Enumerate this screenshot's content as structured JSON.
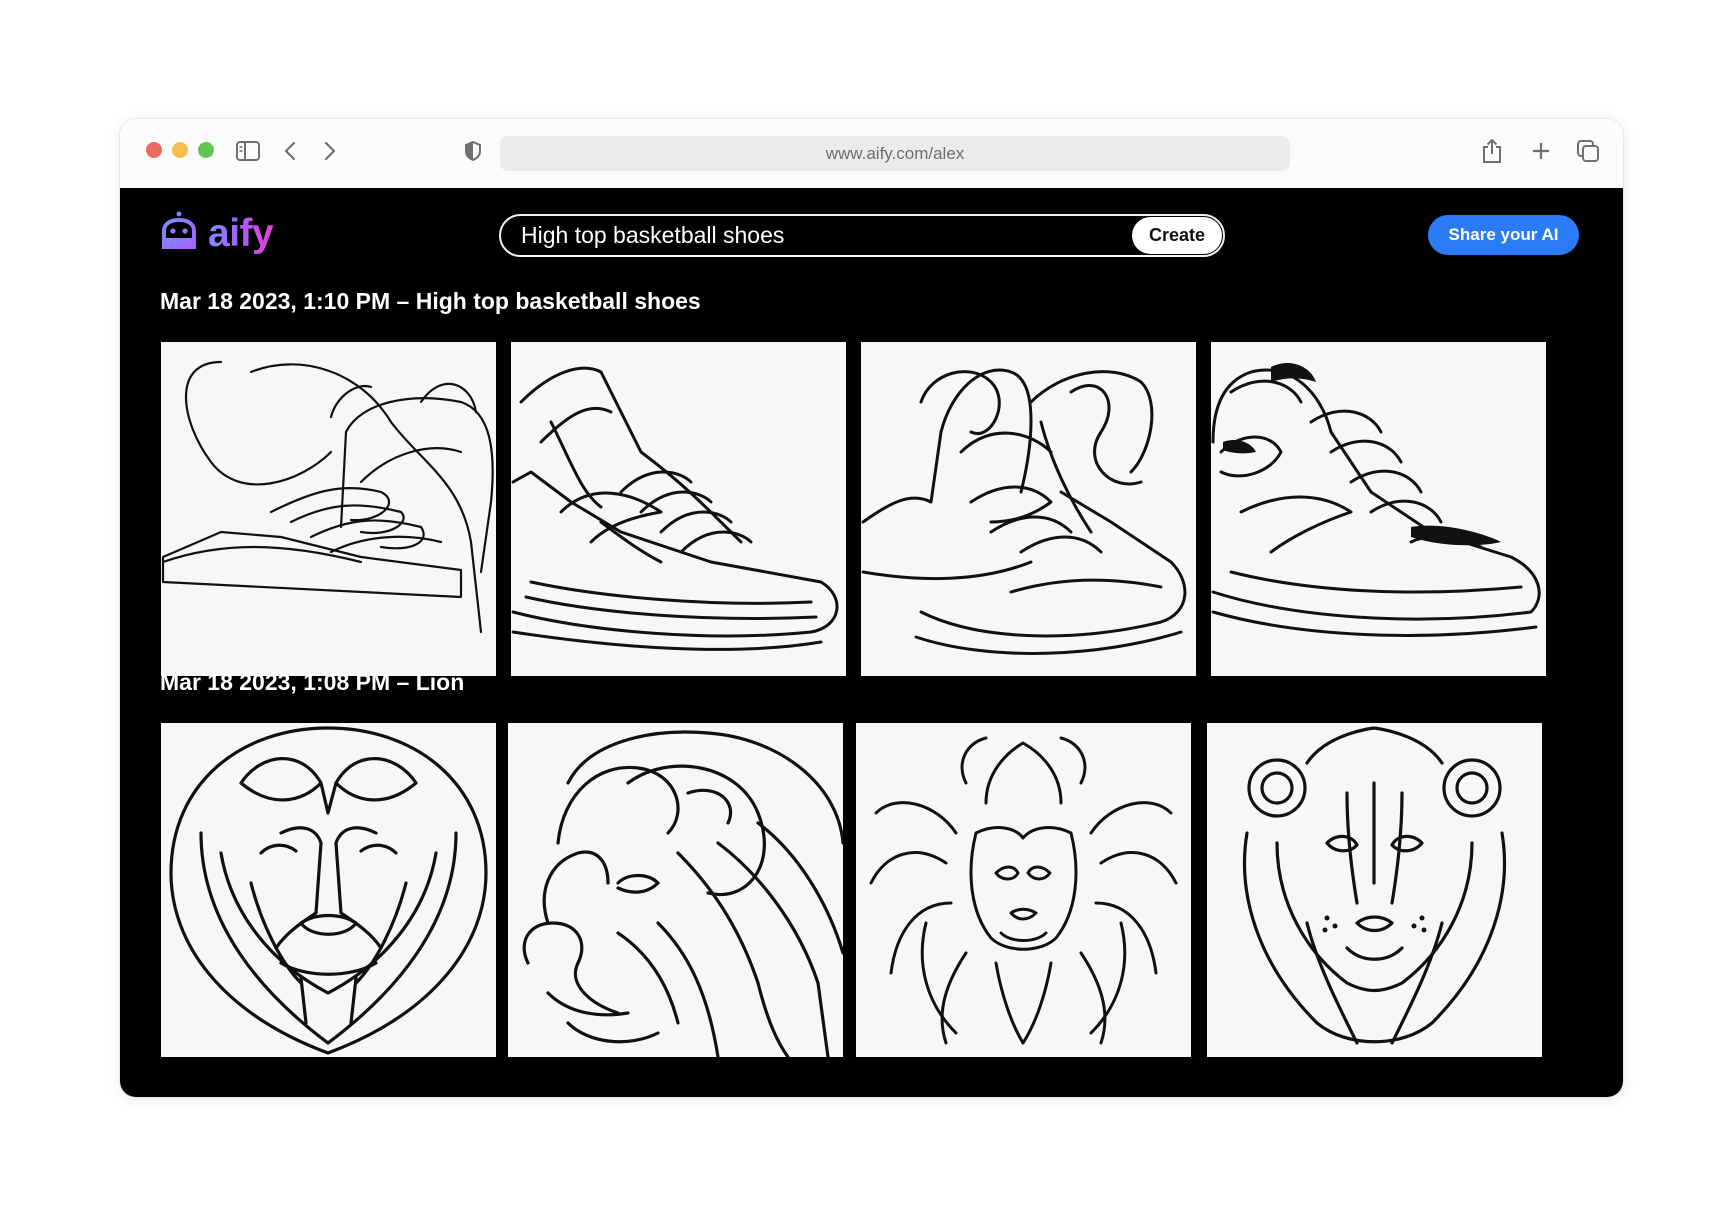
{
  "browser": {
    "url": "www.aify.com/alex",
    "icons": [
      "sidebar-icon",
      "back-icon",
      "forward-icon",
      "shield-icon",
      "share-icon",
      "new-tab-icon",
      "tabs-overview-icon"
    ]
  },
  "header": {
    "logo_text": "aify",
    "logo_icon": "robot-icon",
    "prompt_value": "High top basketball shoes",
    "create_label": "Create",
    "share_label": "Share your AI",
    "accent_color": "#2a7cf6",
    "logo_gradient": [
      "#7b8cff",
      "#b057ff",
      "#e63fd4"
    ]
  },
  "sections": [
    {
      "title": "Mar 18 2023, 1:10 PM – High top basketball shoes",
      "images": [
        "shoe line drawing 1",
        "shoe line drawing 2",
        "shoe line drawing 3",
        "shoe line drawing 4"
      ]
    },
    {
      "title": "Mar 18 2023, 1:08 PM – Lion",
      "images": [
        "lion line drawing 1",
        "lion line drawing 2",
        "lion line drawing 3",
        "lion line drawing 4"
      ]
    }
  ]
}
